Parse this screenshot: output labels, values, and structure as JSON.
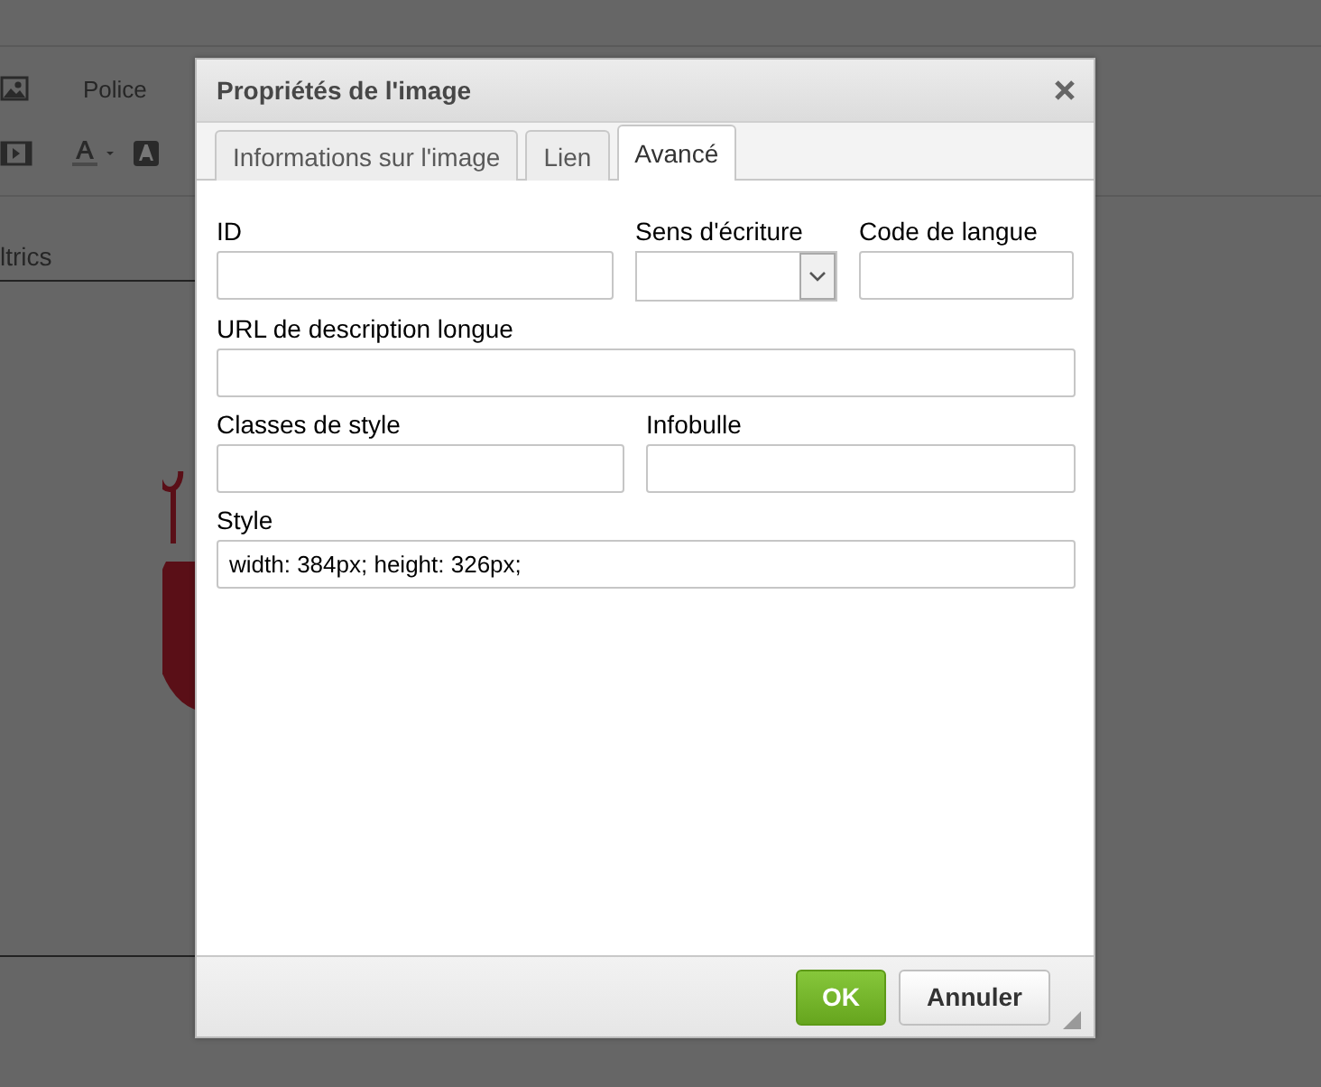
{
  "editor": {
    "toolbar_label": "Police",
    "content_text": "ltrics"
  },
  "dialog": {
    "title": "Propriétés de l'image",
    "tabs": [
      {
        "label": "Informations sur l'image",
        "selected": false
      },
      {
        "label": "Lien",
        "selected": false
      },
      {
        "label": "Avancé",
        "selected": true
      }
    ],
    "rows": [
      {
        "fields": [
          {
            "label": "ID",
            "kind": "text"
          },
          {
            "label": "Sens d'écriture",
            "kind": "select"
          },
          {
            "label": "Code de langue",
            "kind": "text"
          }
        ]
      },
      {
        "fields": [
          {
            "label": "URL de description longue",
            "kind": "text"
          }
        ]
      },
      {
        "fields": [
          {
            "label": "Classes de style",
            "kind": "text"
          },
          {
            "label": "Infobulle",
            "kind": "text"
          }
        ]
      },
      {
        "fields": [
          {
            "label": "Style",
            "kind": "text",
            "value": "width: 384px; height: 326px;"
          }
        ]
      }
    ],
    "buttons": [
      {
        "label": "OK",
        "kind": "primary"
      },
      {
        "label": "Annuler",
        "kind": "secondary"
      }
    ]
  }
}
